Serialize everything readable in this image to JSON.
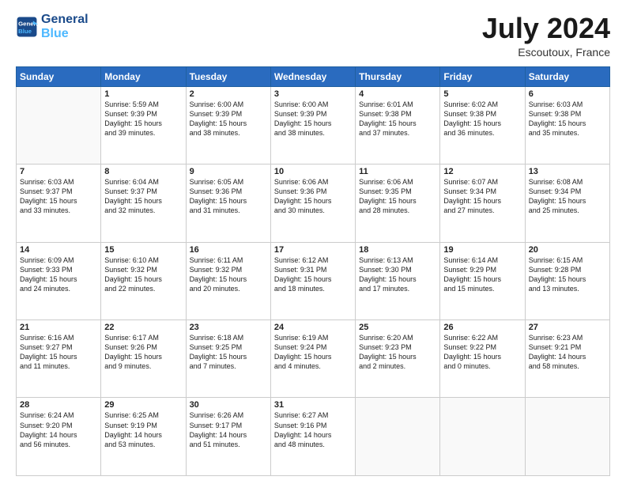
{
  "header": {
    "logo_line1": "General",
    "logo_line2": "Blue",
    "month": "July 2024",
    "location": "Escoutoux, France"
  },
  "weekdays": [
    "Sunday",
    "Monday",
    "Tuesday",
    "Wednesday",
    "Thursday",
    "Friday",
    "Saturday"
  ],
  "weeks": [
    [
      {
        "day": "",
        "info": ""
      },
      {
        "day": "1",
        "info": "Sunrise: 5:59 AM\nSunset: 9:39 PM\nDaylight: 15 hours\nand 39 minutes."
      },
      {
        "day": "2",
        "info": "Sunrise: 6:00 AM\nSunset: 9:39 PM\nDaylight: 15 hours\nand 38 minutes."
      },
      {
        "day": "3",
        "info": "Sunrise: 6:00 AM\nSunset: 9:39 PM\nDaylight: 15 hours\nand 38 minutes."
      },
      {
        "day": "4",
        "info": "Sunrise: 6:01 AM\nSunset: 9:38 PM\nDaylight: 15 hours\nand 37 minutes."
      },
      {
        "day": "5",
        "info": "Sunrise: 6:02 AM\nSunset: 9:38 PM\nDaylight: 15 hours\nand 36 minutes."
      },
      {
        "day": "6",
        "info": "Sunrise: 6:03 AM\nSunset: 9:38 PM\nDaylight: 15 hours\nand 35 minutes."
      }
    ],
    [
      {
        "day": "7",
        "info": "Sunrise: 6:03 AM\nSunset: 9:37 PM\nDaylight: 15 hours\nand 33 minutes."
      },
      {
        "day": "8",
        "info": "Sunrise: 6:04 AM\nSunset: 9:37 PM\nDaylight: 15 hours\nand 32 minutes."
      },
      {
        "day": "9",
        "info": "Sunrise: 6:05 AM\nSunset: 9:36 PM\nDaylight: 15 hours\nand 31 minutes."
      },
      {
        "day": "10",
        "info": "Sunrise: 6:06 AM\nSunset: 9:36 PM\nDaylight: 15 hours\nand 30 minutes."
      },
      {
        "day": "11",
        "info": "Sunrise: 6:06 AM\nSunset: 9:35 PM\nDaylight: 15 hours\nand 28 minutes."
      },
      {
        "day": "12",
        "info": "Sunrise: 6:07 AM\nSunset: 9:34 PM\nDaylight: 15 hours\nand 27 minutes."
      },
      {
        "day": "13",
        "info": "Sunrise: 6:08 AM\nSunset: 9:34 PM\nDaylight: 15 hours\nand 25 minutes."
      }
    ],
    [
      {
        "day": "14",
        "info": "Sunrise: 6:09 AM\nSunset: 9:33 PM\nDaylight: 15 hours\nand 24 minutes."
      },
      {
        "day": "15",
        "info": "Sunrise: 6:10 AM\nSunset: 9:32 PM\nDaylight: 15 hours\nand 22 minutes."
      },
      {
        "day": "16",
        "info": "Sunrise: 6:11 AM\nSunset: 9:32 PM\nDaylight: 15 hours\nand 20 minutes."
      },
      {
        "day": "17",
        "info": "Sunrise: 6:12 AM\nSunset: 9:31 PM\nDaylight: 15 hours\nand 18 minutes."
      },
      {
        "day": "18",
        "info": "Sunrise: 6:13 AM\nSunset: 9:30 PM\nDaylight: 15 hours\nand 17 minutes."
      },
      {
        "day": "19",
        "info": "Sunrise: 6:14 AM\nSunset: 9:29 PM\nDaylight: 15 hours\nand 15 minutes."
      },
      {
        "day": "20",
        "info": "Sunrise: 6:15 AM\nSunset: 9:28 PM\nDaylight: 15 hours\nand 13 minutes."
      }
    ],
    [
      {
        "day": "21",
        "info": "Sunrise: 6:16 AM\nSunset: 9:27 PM\nDaylight: 15 hours\nand 11 minutes."
      },
      {
        "day": "22",
        "info": "Sunrise: 6:17 AM\nSunset: 9:26 PM\nDaylight: 15 hours\nand 9 minutes."
      },
      {
        "day": "23",
        "info": "Sunrise: 6:18 AM\nSunset: 9:25 PM\nDaylight: 15 hours\nand 7 minutes."
      },
      {
        "day": "24",
        "info": "Sunrise: 6:19 AM\nSunset: 9:24 PM\nDaylight: 15 hours\nand 4 minutes."
      },
      {
        "day": "25",
        "info": "Sunrise: 6:20 AM\nSunset: 9:23 PM\nDaylight: 15 hours\nand 2 minutes."
      },
      {
        "day": "26",
        "info": "Sunrise: 6:22 AM\nSunset: 9:22 PM\nDaylight: 15 hours\nand 0 minutes."
      },
      {
        "day": "27",
        "info": "Sunrise: 6:23 AM\nSunset: 9:21 PM\nDaylight: 14 hours\nand 58 minutes."
      }
    ],
    [
      {
        "day": "28",
        "info": "Sunrise: 6:24 AM\nSunset: 9:20 PM\nDaylight: 14 hours\nand 56 minutes."
      },
      {
        "day": "29",
        "info": "Sunrise: 6:25 AM\nSunset: 9:19 PM\nDaylight: 14 hours\nand 53 minutes."
      },
      {
        "day": "30",
        "info": "Sunrise: 6:26 AM\nSunset: 9:17 PM\nDaylight: 14 hours\nand 51 minutes."
      },
      {
        "day": "31",
        "info": "Sunrise: 6:27 AM\nSunset: 9:16 PM\nDaylight: 14 hours\nand 48 minutes."
      },
      {
        "day": "",
        "info": ""
      },
      {
        "day": "",
        "info": ""
      },
      {
        "day": "",
        "info": ""
      }
    ]
  ]
}
